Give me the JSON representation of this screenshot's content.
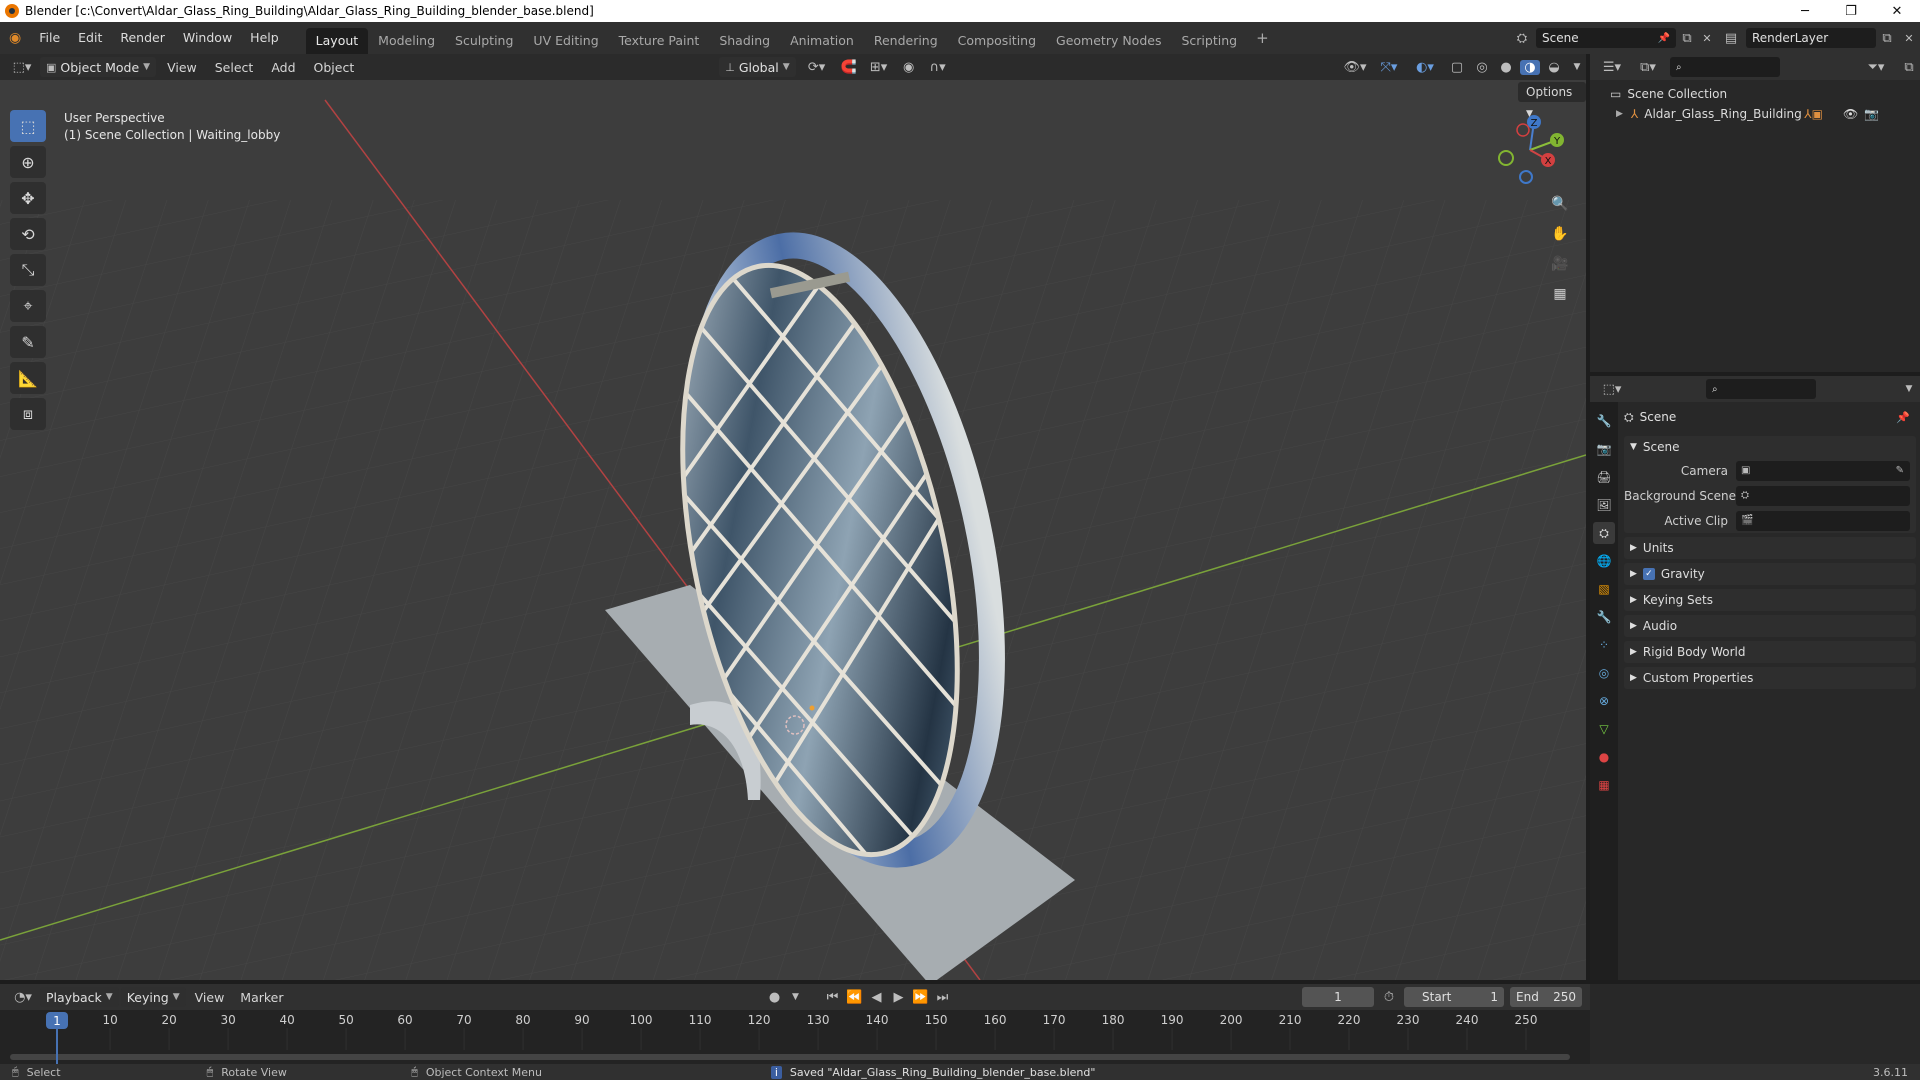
{
  "window": {
    "title": "Blender [c:\\Convert\\Aldar_Glass_Ring_Building\\Aldar_Glass_Ring_Building_blender_base.blend]",
    "minimize": "─",
    "maximize": "❐",
    "close": "✕"
  },
  "menu": {
    "file": "File",
    "edit": "Edit",
    "render": "Render",
    "window": "Window",
    "help": "Help"
  },
  "workspaces": [
    "Layout",
    "Modeling",
    "Sculpting",
    "UV Editing",
    "Texture Paint",
    "Shading",
    "Animation",
    "Rendering",
    "Compositing",
    "Geometry Nodes",
    "Scripting"
  ],
  "active_workspace": "Layout",
  "add_workspace": "+",
  "scene_selector": {
    "value": "Scene"
  },
  "renderlayer_selector": {
    "value": "RenderLayer"
  },
  "viewport_header": {
    "mode": "Object Mode",
    "view": "View",
    "select": "Select",
    "add": "Add",
    "object": "Object",
    "orientation": "Global",
    "options": "Options"
  },
  "viewport": {
    "perspective": "User Perspective",
    "collection_info": "(1) Scene Collection | Waiting_lobby",
    "gizmo": {
      "z": "Z",
      "y": "Y",
      "x": "X"
    }
  },
  "outliner": {
    "search_placeholder": "",
    "root": "Scene Collection",
    "items": [
      "Aldar_Glass_Ring_Building"
    ]
  },
  "properties": {
    "context": "Scene",
    "panel_title": "Scene",
    "fields": {
      "camera": "Camera",
      "background_scene": "Background Scene",
      "active_clip": "Active Clip"
    },
    "panels": [
      "Units",
      "Gravity",
      "Keying Sets",
      "Audio",
      "Rigid Body World",
      "Custom Properties"
    ],
    "gravity_checked": true
  },
  "timeline": {
    "playback": "Playback",
    "keying": "Keying",
    "view": "View",
    "marker": "Marker",
    "current_frame": "1",
    "start_label": "Start",
    "start_value": "1",
    "end_label": "End",
    "end_value": "250",
    "ticks": [
      "1",
      "10",
      "20",
      "30",
      "40",
      "50",
      "60",
      "70",
      "80",
      "90",
      "100",
      "110",
      "120",
      "130",
      "140",
      "150",
      "160",
      "170",
      "180",
      "190",
      "200",
      "210",
      "220",
      "230",
      "240",
      "250"
    ],
    "playhead_frame": "1"
  },
  "statusbar": {
    "select": "Select",
    "rotate_view": "Rotate View",
    "object_context_menu": "Object Context Menu",
    "message": "Saved \"Aldar_Glass_Ring_Building_blender_base.blend\"",
    "version": "3.6.11"
  },
  "colors": {
    "accent": "#4772b3",
    "viewport_bg": "#3d3d3d",
    "axis_x": "#c24a4a",
    "axis_y": "#7aa23a",
    "brand": "#ea7600"
  }
}
